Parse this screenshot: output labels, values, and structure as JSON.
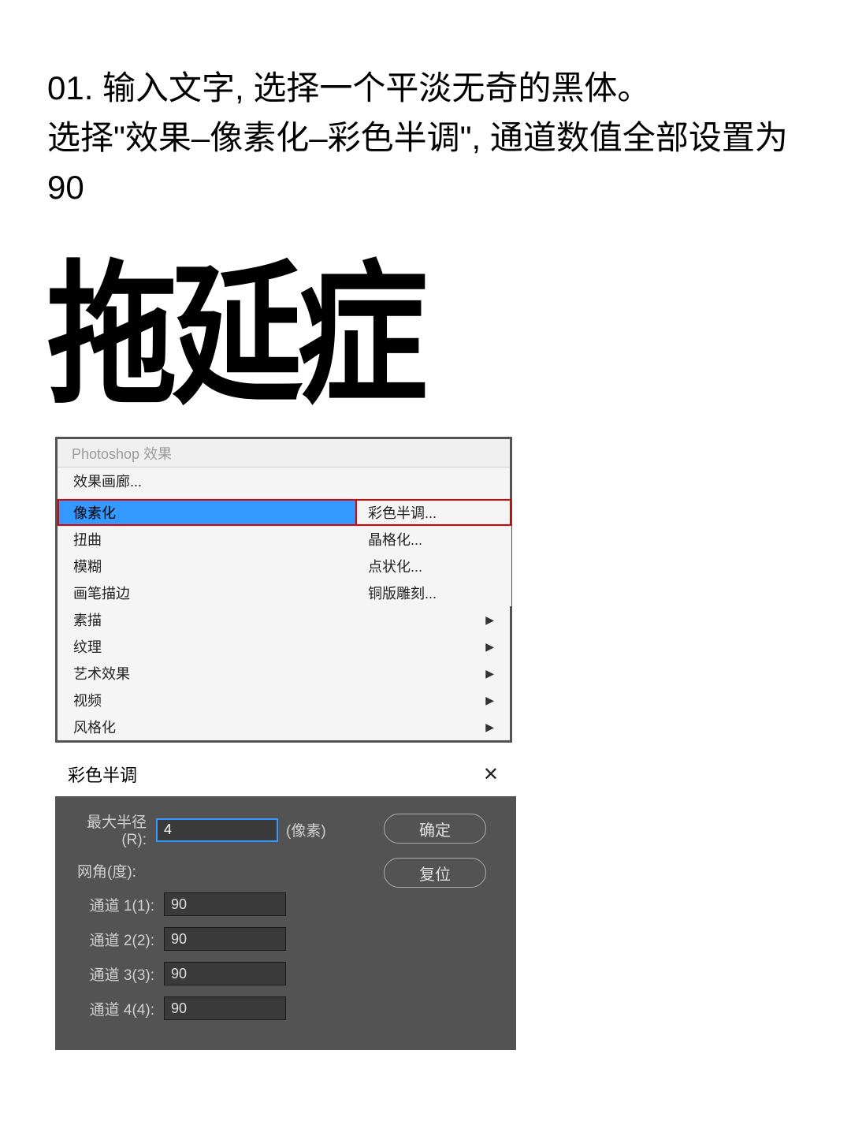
{
  "instructions": {
    "line1": "01.  输入文字, 选择一个平淡无奇的黑体。",
    "line2": "选择\"效果–像素化–彩色半调\", 通道数值全部设置为90"
  },
  "sample_text": "拖延症",
  "menu": {
    "header": "Photoshop 效果",
    "gallery": "效果画廊...",
    "pixelate": "像素化",
    "distort": "扭曲",
    "blur": "模糊",
    "brush": "画笔描边",
    "sketch": "素描",
    "texture": "纹理",
    "artistic": "艺术效果",
    "video": "视频",
    "stylize": "风格化"
  },
  "submenu": {
    "color_halftone": "彩色半调...",
    "crystallize": "晶格化...",
    "pointillize": "点状化...",
    "mezzotint": "铜版雕刻..."
  },
  "dialog": {
    "title": "彩色半调",
    "close": "✕",
    "max_radius_label": "最大半径(R):",
    "max_radius_value": "4",
    "unit": "(像素)",
    "angle_label": "网角(度):",
    "ch1_label": "通道 1(1):",
    "ch1_value": "90",
    "ch2_label": "通道 2(2):",
    "ch2_value": "90",
    "ch3_label": "通道 3(3):",
    "ch3_value": "90",
    "ch4_label": "通道 4(4):",
    "ch4_value": "90",
    "ok": "确定",
    "reset": "复位"
  }
}
